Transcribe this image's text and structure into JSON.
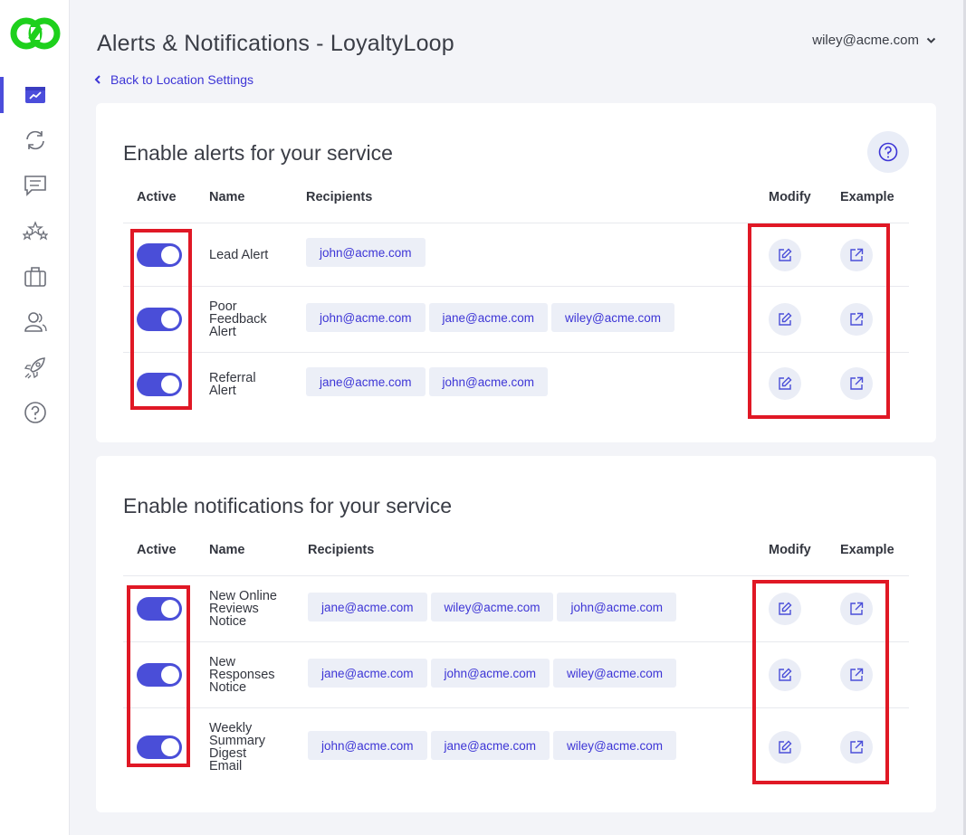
{
  "header": {
    "title": "Alerts & Notifications - LoyaltyLoop",
    "user": "wiley@acme.com",
    "back_link": "Back to Location Settings"
  },
  "sidebar": {
    "items": [
      {
        "icon": "dashboard-icon",
        "active": true
      },
      {
        "icon": "sync-icon",
        "active": false
      },
      {
        "icon": "chat-icon",
        "active": false
      },
      {
        "icon": "stars-icon",
        "active": false
      },
      {
        "icon": "briefcase-icon",
        "active": false
      },
      {
        "icon": "users-icon",
        "active": false
      },
      {
        "icon": "rocket-icon",
        "active": false
      },
      {
        "icon": "help-icon",
        "active": false
      }
    ]
  },
  "alerts": {
    "title": "Enable alerts for your service",
    "columns": {
      "active": "Active",
      "name": "Name",
      "recipients": "Recipients",
      "modify": "Modify",
      "example": "Example"
    },
    "rows": [
      {
        "name": "Lead Alert",
        "active": true,
        "recipients": [
          "john@acme.com"
        ]
      },
      {
        "name": "Poor Feedback Alert",
        "active": true,
        "recipients": [
          "john@acme.com",
          "jane@acme.com",
          "wiley@acme.com"
        ]
      },
      {
        "name": "Referral Alert",
        "active": true,
        "recipients": [
          "jane@acme.com",
          "john@acme.com"
        ]
      }
    ]
  },
  "notifications": {
    "title": "Enable notifications for your service",
    "columns": {
      "active": "Active",
      "name": "Name",
      "recipients": "Recipients",
      "modify": "Modify",
      "example": "Example"
    },
    "rows": [
      {
        "name": "New Online Reviews Notice",
        "active": true,
        "recipients": [
          "jane@acme.com",
          "wiley@acme.com",
          "john@acme.com"
        ]
      },
      {
        "name": "New Responses Notice",
        "active": true,
        "recipients": [
          "jane@acme.com",
          "john@acme.com",
          "wiley@acme.com"
        ]
      },
      {
        "name": "Weekly Summary Digest Email",
        "active": true,
        "recipients": [
          "john@acme.com",
          "jane@acme.com",
          "wiley@acme.com"
        ]
      }
    ]
  },
  "colors": {
    "accent": "#4a4ed8",
    "link": "#3d35d6",
    "logo": "#1ed01c",
    "highlight": "#e01825"
  }
}
